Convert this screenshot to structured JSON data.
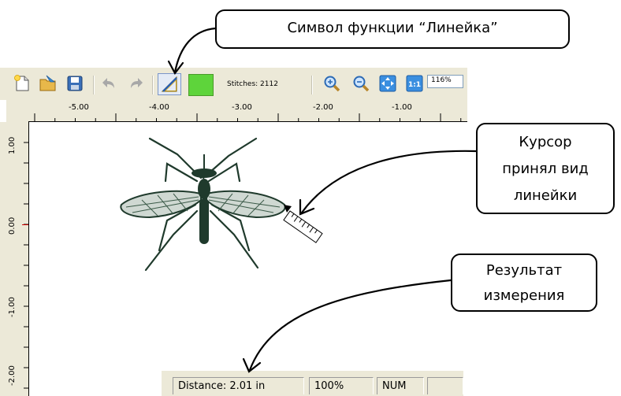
{
  "toolbar": {
    "stitches_label": "Stitches: 2112",
    "zoom_value": "116%",
    "color_swatch": "#5ed43b"
  },
  "ruler": {
    "h_labels": [
      "-5.00",
      "-4.00",
      "-3.00",
      "-2.00",
      "-1.00"
    ],
    "v_labels": [
      "1.00",
      "0.00",
      "-1.00",
      "-2.00"
    ]
  },
  "status": {
    "distance": "Distance: 2.01 in",
    "zoom": "100%",
    "num": "NUM"
  },
  "callouts": {
    "ruler_symbol": "Символ функции “Линейка”",
    "cursor_line1": "Курсор",
    "cursor_line2": "принял вид",
    "cursor_line3": "линейки",
    "result_line1": "Результат",
    "result_line2": "измерения"
  },
  "icons": [
    "new-file-icon",
    "open-file-icon",
    "save-icon",
    "undo-icon",
    "redo-icon",
    "ruler-tool-icon",
    "color-swatch",
    "zoom-in-icon",
    "zoom-out-icon",
    "fit-to-window-icon",
    "actual-size-icon",
    "ruler-cursor-icon"
  ]
}
